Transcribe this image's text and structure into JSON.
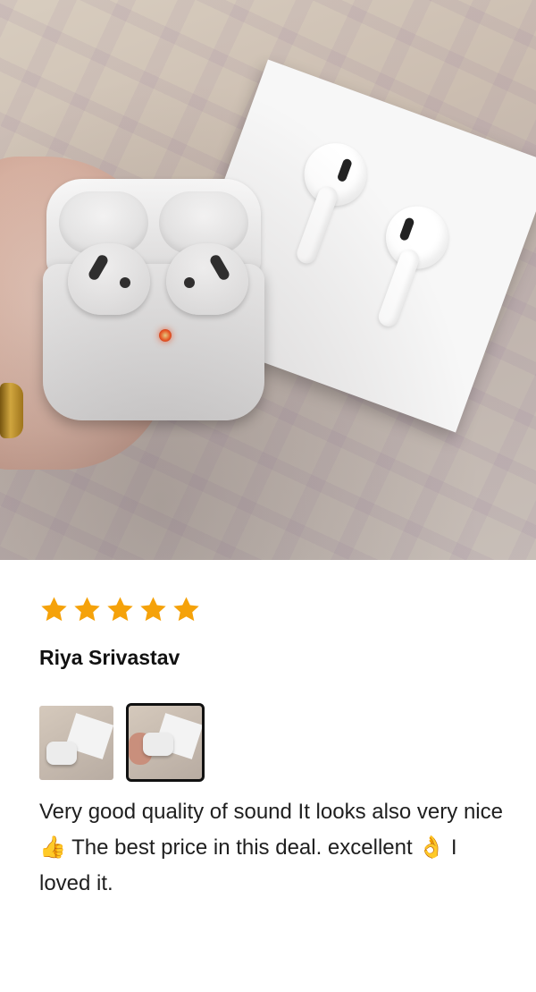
{
  "product_photo": {
    "description_icon": "airpods-photo"
  },
  "review": {
    "rating": 5,
    "rating_max": 5,
    "star_color": "#F5A20A",
    "reviewer_name": "Riya Srivastav",
    "thumbnails": [
      {
        "icon": "airpods-thumbnail",
        "selected": false
      },
      {
        "icon": "airpods-in-hand-thumbnail",
        "selected": true
      }
    ],
    "text": "Very good quality of sound It looks also very nice 👍 The best price in this deal. excellent 👌 I loved it."
  }
}
